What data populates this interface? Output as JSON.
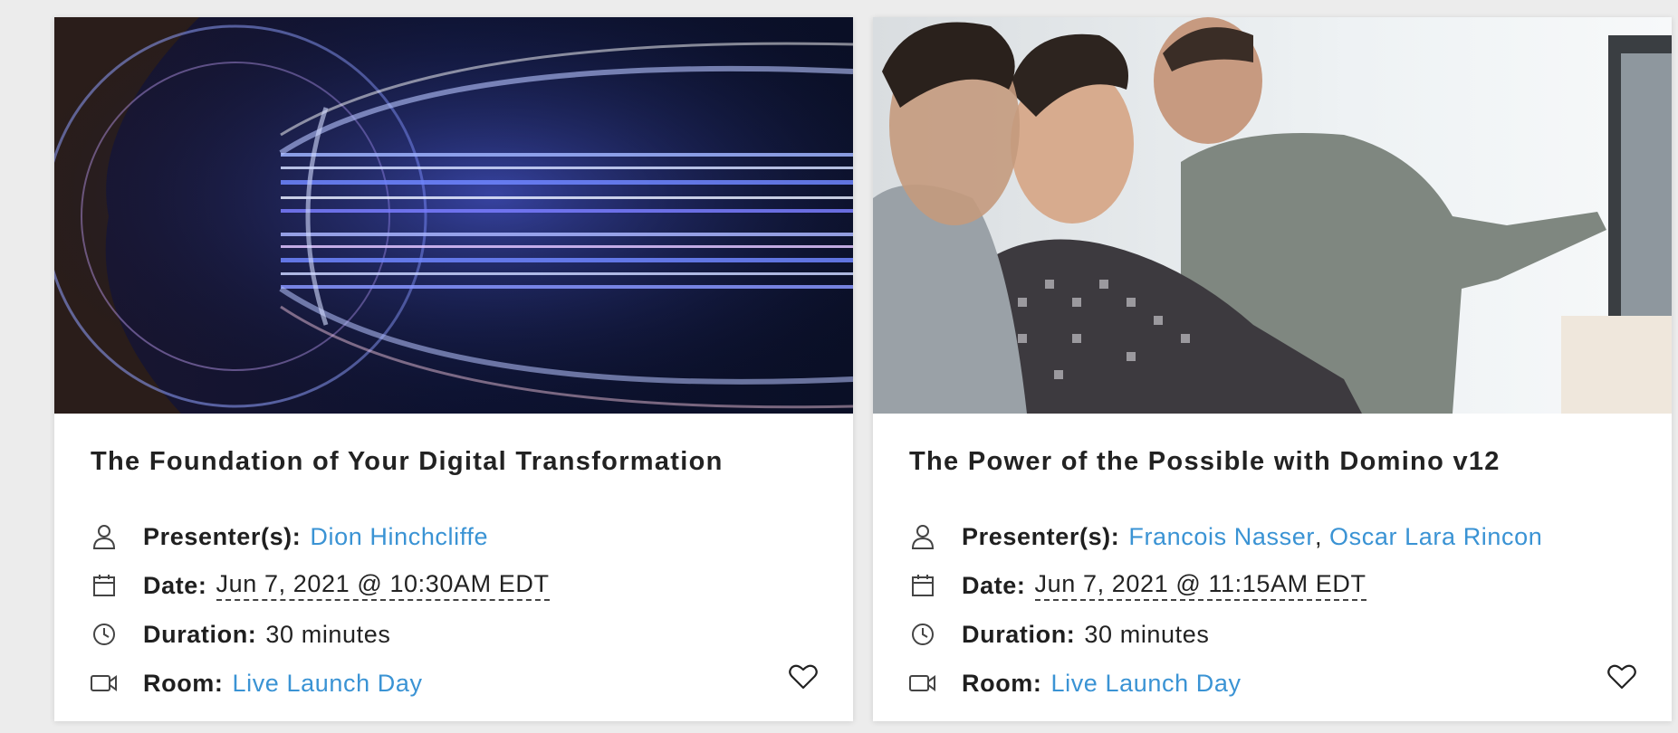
{
  "sessions": [
    {
      "title": "The Foundation of Your Digital Transformation",
      "image_alt": "aerial view of highway interchange with light trails",
      "presenters_label": "Presenter(s):",
      "presenters": [
        "Dion Hinchcliffe"
      ],
      "date_label": "Date:",
      "date": "Jun 7, 2021 @ 10:30AM EDT",
      "duration_label": "Duration:",
      "duration": "30 minutes",
      "room_label": "Room:",
      "room": "Live Launch Day",
      "icons": {
        "presenter": "user-icon",
        "date": "calendar-icon",
        "duration": "clock-icon",
        "room": "video-camera-icon",
        "favorite": "heart-icon"
      }
    },
    {
      "title": "The Power of the Possible with Domino v12",
      "image_alt": "three men looking at a computer monitor",
      "presenters_label": "Presenter(s):",
      "presenters": [
        "Francois Nasser",
        "Oscar Lara Rincon"
      ],
      "presenter_separator": ",",
      "date_label": "Date:",
      "date": "Jun 7, 2021 @ 11:15AM EDT",
      "duration_label": "Duration:",
      "duration": "30 minutes",
      "room_label": "Room:",
      "room": "Live Launch Day",
      "icons": {
        "presenter": "user-icon",
        "date": "calendar-icon",
        "duration": "clock-icon",
        "room": "video-camera-icon",
        "favorite": "heart-icon"
      }
    }
  ],
  "colors": {
    "link": "#3a93d4",
    "background": "#ececec",
    "card": "#ffffff",
    "text": "#222222"
  }
}
